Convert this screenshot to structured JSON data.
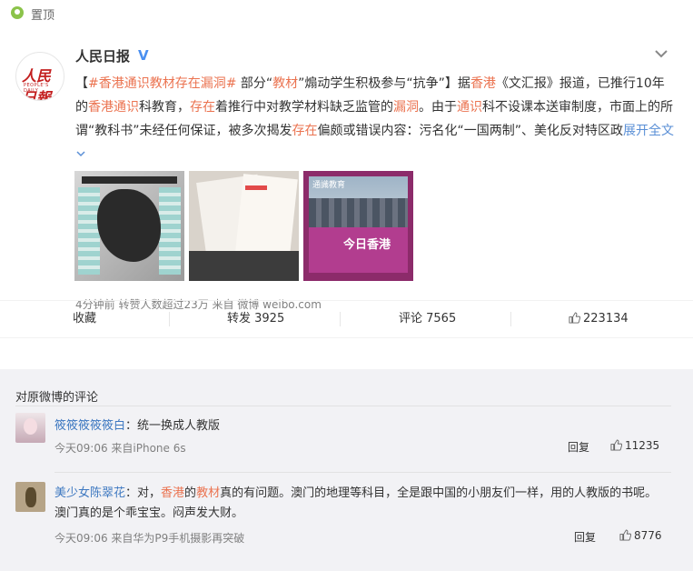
{
  "pin": {
    "label": "置顶"
  },
  "post": {
    "author": "人民日报",
    "avatar_brand": "人民日報",
    "avatar_brand_en": "PEOPLE'S DAILY",
    "verified_glyph": "V",
    "text": {
      "bracket_open": "【",
      "topic": "#香港通识教材存在漏洞#",
      "p1": " 部分“",
      "w_jiaocai": "教材",
      "p2": "”煽动学生积极参与“抗争”】据",
      "w_hk": "香港",
      "p3": "《文汇报》报道，已推行10年的",
      "w_hktongshi": "香港通识",
      "p4": "科教育，",
      "w_cunzai1": "存在",
      "p5": "着推行中对教学材料缺乏监管的",
      "w_loudong": "漏洞",
      "p6": "。由于",
      "w_tongshi": "通识",
      "p7": "科不设课本送审制度，市面上的所谓“教科书”未经任何保证，被多次揭发",
      "w_cunzai2": "存在",
      "p8": "偏颇或错误内容：污名化“一国两制”、美化反对特区政",
      "expand": "展开全文"
    },
    "thumb3_logo": "通識教育",
    "thumb3_title": "今日香港",
    "meta": "4分钟前 转赞人数超过23万  来自 微博 weibo.com"
  },
  "actions": {
    "collect": "收藏",
    "repost": "转发 3925",
    "comment": "评论 7565",
    "like": "223134"
  },
  "comments": {
    "title": "对原微博的评论",
    "items": [
      {
        "name": "筱筱筱筱筱白",
        "text": "：统一换成人教版",
        "time": "今天09:06 来自iPhone 6s",
        "reply": "回复",
        "likes": "11235"
      },
      {
        "name": "美少女陈翠花",
        "text_a": "：对，",
        "hl1": "香港",
        "text_b": "的",
        "hl2": "教材",
        "text_c": "真的有问题。澳门的地理等科目，全是跟中国的小朋友们一样，用的人教版的书呢。",
        "text_line2": "澳门真的是个乖宝宝。闷声发大财。",
        "time": "今天09:06 来自华为P9手机摄影再突破",
        "reply": "回复",
        "likes": "8776"
      }
    ]
  },
  "colors": {
    "highlight": "#eb7350",
    "link_blue": "#3f79c1",
    "expand_blue": "#5a8fd6",
    "comment_bg": "#f2f2f5"
  }
}
